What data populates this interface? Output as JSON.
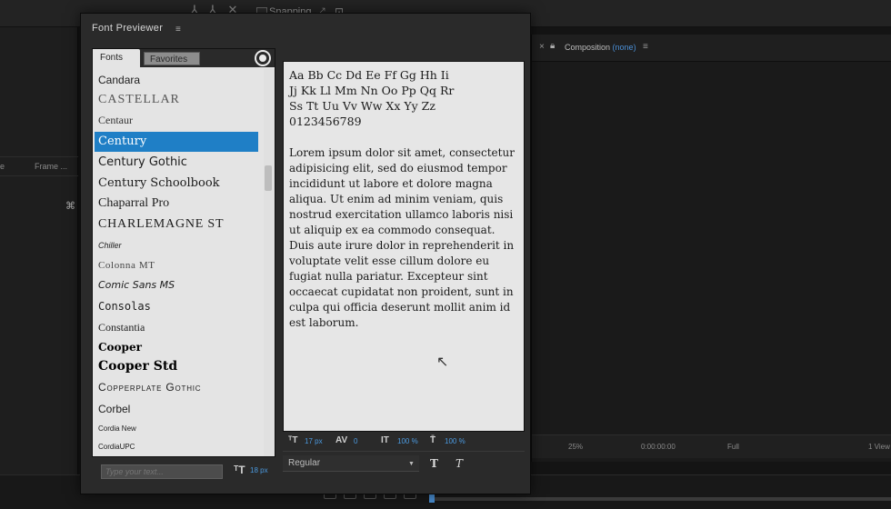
{
  "host": {
    "snapping_label": "Snapping",
    "left_panel_header": [
      "e",
      "Frame ..."
    ],
    "composition": {
      "title": "Composition",
      "title_suffix": "(none)",
      "zoom": "25%",
      "timecode": "0:00:00:00",
      "resolution": "Full",
      "views": "1 View"
    }
  },
  "window": {
    "title": "Font  Previewer",
    "menu_icon": "menu-icon"
  },
  "tabs": {
    "fonts": "Fonts",
    "favorites": "Favorites"
  },
  "fonts": [
    {
      "name": "Candara"
    },
    {
      "name": "CASTELLAR"
    },
    {
      "name": "Centaur"
    },
    {
      "name": "Century",
      "selected": true
    },
    {
      "name": "Century Gothic"
    },
    {
      "name": "Century Schoolbook"
    },
    {
      "name": "Chaparral Pro"
    },
    {
      "name": "CHARLEMAGNE ST"
    },
    {
      "name": "Chiller"
    },
    {
      "name": "Colonna MT"
    },
    {
      "name": "Comic Sans MS"
    },
    {
      "name": "Consolas"
    },
    {
      "name": "Constantia"
    },
    {
      "name": "Cooper"
    },
    {
      "name": "Cooper Std"
    },
    {
      "name": "Copperplate Gothic"
    },
    {
      "name": "Corbel"
    },
    {
      "name": "Cordia New"
    },
    {
      "name": "CordiaUPC"
    }
  ],
  "preview": {
    "alphabet": [
      "Aa Bb Cc Dd Ee Ff Gg Hh Ii",
      "Jj Kk Ll Mm Nn Oo Pp Qq Rr",
      "Ss Tt Uu Vv Ww Xx Yy Zz",
      "0123456789"
    ],
    "lorem": "Lorem ipsum dolor sit amet, consectetur adipisicing elit, sed do eiusmod tempor incididunt ut labore et dolore magna aliqua. Ut enim ad minim veniam, quis nostrud exercitation ullamco laboris nisi ut aliquip ex ea commodo consequat. Duis aute irure dolor in reprehenderit in voluptate velit esse cillum dolore eu fugiat nulla pariatur. Excepteur sint occaecat cupidatat non proident, sunt in culpa qui officia deserunt mollit anim id est laborum."
  },
  "controls": {
    "font_size": "17 px",
    "tracking": "0",
    "vertical_scale": "100 %",
    "horizontal_scale": "100 %",
    "style": "Regular",
    "type_placeholder": "Type your text...",
    "list_size": "18 px"
  }
}
